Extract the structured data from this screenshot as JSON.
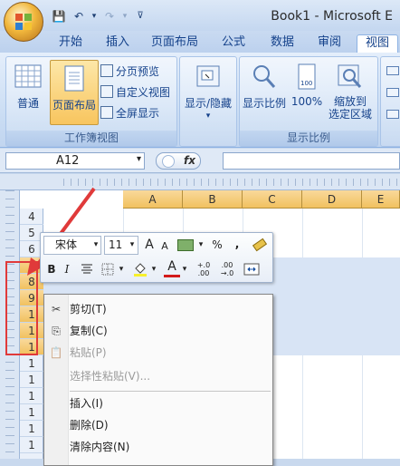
{
  "window": {
    "title": "Book1 - Microsoft E"
  },
  "qat": {
    "save": "💾",
    "undo": "↶",
    "undo_drop": "▾",
    "redo": "↷",
    "redo_drop": "▾",
    "customize": "⊽"
  },
  "tabs": [
    {
      "label": "开始"
    },
    {
      "label": "插入"
    },
    {
      "label": "页面布局"
    },
    {
      "label": "公式"
    },
    {
      "label": "数据"
    },
    {
      "label": "审阅"
    },
    {
      "label": "视图"
    }
  ],
  "ribbon": {
    "workbook_views": {
      "label": "工作簿视图",
      "normal": "普通",
      "page_layout": "页面布局",
      "page_break_preview": "分页预览",
      "custom_views": "自定义视图",
      "full_screen": "全屏显示"
    },
    "show_hide": {
      "label": "显示/隐藏",
      "arrow": "▾"
    },
    "zoom": {
      "label": "显示比例",
      "zoom": "显示比例",
      "hundred": "100%",
      "hundred_icon": "100",
      "zoom_to_selection_1": "缩放到",
      "zoom_to_selection_2": "选定区域"
    }
  },
  "formula_bar": {
    "name_box": "A12",
    "name_arrow": "▾",
    "fx": "fx"
  },
  "columns": [
    "A",
    "B",
    "C",
    "D",
    "E"
  ],
  "rows": [
    "4",
    "5",
    "6",
    "7",
    "8",
    "9",
    "1",
    "1",
    "1",
    "1",
    "1",
    "1",
    "1",
    "1",
    "1"
  ],
  "mini_toolbar": {
    "font_name": "宋体",
    "font_size": "11",
    "dropdown_arrow": "▾",
    "grow_font": "A",
    "shrink_font": "A",
    "percent": "%",
    "comma": ",",
    "bold": "B",
    "italic": "I",
    "font_color": "A",
    "inc_decimal": "+.0 .00",
    "dec_decimal": ".00 →.0"
  },
  "context_menu": [
    {
      "label": "剪切(T)",
      "icon": "✂",
      "disabled": false
    },
    {
      "label": "复制(C)",
      "icon": "⎘",
      "disabled": false
    },
    {
      "label": "粘贴(P)",
      "icon": "📋",
      "disabled": true
    },
    {
      "label": "选择性粘贴(V)...",
      "icon": "",
      "disabled": true
    },
    {
      "label": "插入(I)",
      "icon": "",
      "disabled": false
    },
    {
      "label": "删除(D)",
      "icon": "",
      "disabled": false
    },
    {
      "label": "清除内容(N)",
      "icon": "",
      "disabled": false
    }
  ],
  "annotation": {
    "label": "1",
    "color": "#e03a3a"
  }
}
